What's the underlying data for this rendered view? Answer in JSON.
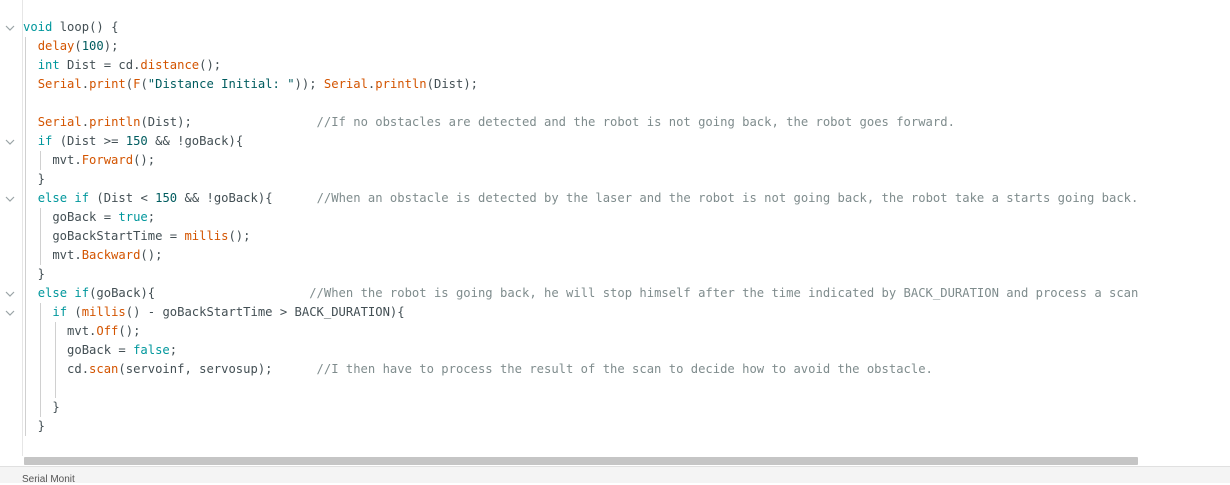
{
  "editor": {
    "lines": [
      {
        "segments": [
          {
            "t": "void",
            "c": "kw"
          },
          {
            "t": " "
          },
          {
            "t": "loop",
            "c": "pl"
          },
          {
            "t": "() {"
          }
        ]
      },
      {
        "segments": [
          {
            "t": "  "
          },
          {
            "t": "delay",
            "c": "fn"
          },
          {
            "t": "("
          },
          {
            "t": "100",
            "c": "num"
          },
          {
            "t": ");"
          }
        ]
      },
      {
        "segments": [
          {
            "t": "  "
          },
          {
            "t": "int",
            "c": "ty"
          },
          {
            "t": " Dist = cd."
          },
          {
            "t": "distance",
            "c": "fn"
          },
          {
            "t": "();"
          }
        ]
      },
      {
        "segments": [
          {
            "t": "  "
          },
          {
            "t": "Serial",
            "c": "fn"
          },
          {
            "t": "."
          },
          {
            "t": "print",
            "c": "fn"
          },
          {
            "t": "("
          },
          {
            "t": "F",
            "c": "fn"
          },
          {
            "t": "("
          },
          {
            "t": "\"Distance Initial: \"",
            "c": "str"
          },
          {
            "t": ")); "
          },
          {
            "t": "Serial",
            "c": "fn"
          },
          {
            "t": "."
          },
          {
            "t": "println",
            "c": "fn"
          },
          {
            "t": "(Dist);"
          }
        ]
      },
      {
        "segments": [
          {
            "t": ""
          }
        ]
      },
      {
        "segments": [
          {
            "t": "  "
          },
          {
            "t": "Serial",
            "c": "fn"
          },
          {
            "t": "."
          },
          {
            "t": "println",
            "c": "fn"
          },
          {
            "t": "(Dist);                 "
          },
          {
            "t": "//If no obstacles are detected and the robot is not going back, the robot goes forward.",
            "c": "cm"
          }
        ]
      },
      {
        "segments": [
          {
            "t": "  "
          },
          {
            "t": "if",
            "c": "kw"
          },
          {
            "t": " (Dist >= "
          },
          {
            "t": "150",
            "c": "num"
          },
          {
            "t": " && !goBack){"
          }
        ]
      },
      {
        "segments": [
          {
            "t": "    mvt."
          },
          {
            "t": "Forward",
            "c": "fn"
          },
          {
            "t": "();"
          }
        ]
      },
      {
        "segments": [
          {
            "t": "  }"
          }
        ]
      },
      {
        "segments": [
          {
            "t": "  "
          },
          {
            "t": "else",
            "c": "kw"
          },
          {
            "t": " "
          },
          {
            "t": "if",
            "c": "kw"
          },
          {
            "t": " (Dist < "
          },
          {
            "t": "150",
            "c": "num"
          },
          {
            "t": " && !goBack){      "
          },
          {
            "t": "//When an obstacle is detected by the laser and the robot is not going back, the robot take a starts going back.",
            "c": "cm"
          }
        ]
      },
      {
        "segments": [
          {
            "t": "    goBack = "
          },
          {
            "t": "true",
            "c": "kw"
          },
          {
            "t": ";"
          }
        ]
      },
      {
        "segments": [
          {
            "t": "    goBackStartTime = "
          },
          {
            "t": "millis",
            "c": "fn"
          },
          {
            "t": "();"
          }
        ]
      },
      {
        "segments": [
          {
            "t": "    mvt."
          },
          {
            "t": "Backward",
            "c": "fn"
          },
          {
            "t": "();"
          }
        ]
      },
      {
        "segments": [
          {
            "t": "  }"
          }
        ]
      },
      {
        "segments": [
          {
            "t": "  "
          },
          {
            "t": "else",
            "c": "kw"
          },
          {
            "t": " "
          },
          {
            "t": "if",
            "c": "kw"
          },
          {
            "t": "(goBack){                     "
          },
          {
            "t": "//When the robot is going back, he will stop himself after the time indicated by BACK_DURATION and process a scan",
            "c": "cm"
          }
        ]
      },
      {
        "segments": [
          {
            "t": "    "
          },
          {
            "t": "if",
            "c": "kw"
          },
          {
            "t": " ("
          },
          {
            "t": "millis",
            "c": "fn"
          },
          {
            "t": "() - goBackStartTime > BACK_DURATION){"
          }
        ]
      },
      {
        "segments": [
          {
            "t": "      mvt."
          },
          {
            "t": "Off",
            "c": "fn"
          },
          {
            "t": "();"
          }
        ]
      },
      {
        "segments": [
          {
            "t": "      goBack = "
          },
          {
            "t": "false",
            "c": "kw"
          },
          {
            "t": ";"
          }
        ]
      },
      {
        "segments": [
          {
            "t": "      cd."
          },
          {
            "t": "scan",
            "c": "fn"
          },
          {
            "t": "(servoinf, servosup);      "
          },
          {
            "t": "//I then have to process the result of the scan to decide how to avoid the obstacle.",
            "c": "cm"
          }
        ]
      },
      {
        "segments": [
          {
            "t": ""
          }
        ]
      },
      {
        "segments": [
          {
            "t": "    }"
          }
        ]
      },
      {
        "segments": [
          {
            "t": "  }"
          }
        ]
      }
    ]
  },
  "bottom_panel": {
    "label": "Serial Monit"
  }
}
